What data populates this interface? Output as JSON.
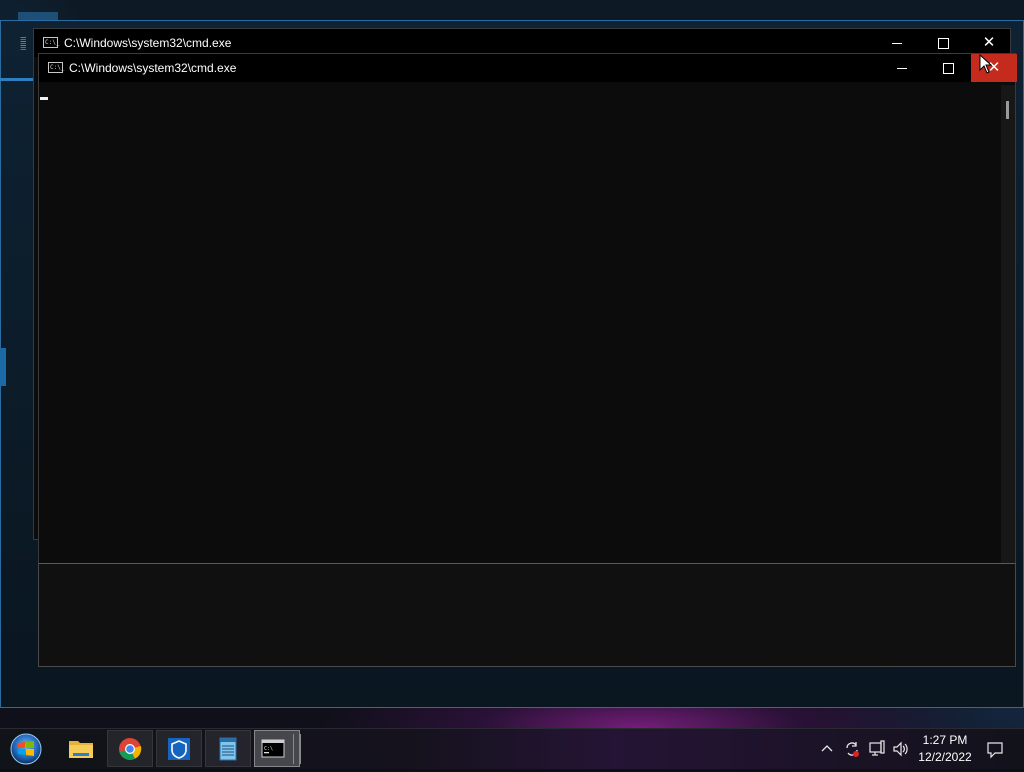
{
  "windows": [
    {
      "id": "cmd-back",
      "title": "C:\\Windows\\system32\\cmd.exe",
      "icon": "cmd-icon",
      "controls": {
        "minimize": "minimize-icon",
        "maximize": "maximize-icon",
        "close": "close-icon"
      }
    },
    {
      "id": "cmd-front",
      "title": "C:\\Windows\\system32\\cmd.exe",
      "icon": "cmd-icon",
      "controls": {
        "minimize": "minimize-icon",
        "maximize": "maximize-icon",
        "close": "close-icon"
      },
      "close_hover_color": "#c42b1c",
      "console_text": ""
    }
  ],
  "taskbar": {
    "start_icon": "windows-start-icon",
    "items": [
      {
        "name": "file-explorer",
        "icon": "folder-icon",
        "state": "normal"
      },
      {
        "name": "chrome",
        "icon": "chrome-icon",
        "state": "pinned"
      },
      {
        "name": "windows-defender",
        "icon": "shield-icon",
        "state": "pinned"
      },
      {
        "name": "notepad",
        "icon": "notepad-icon",
        "state": "pinned"
      },
      {
        "name": "command-prompt",
        "icon": "cmd-icon",
        "state": "active"
      }
    ],
    "tray": {
      "icons": [
        "chevron-up-icon",
        "sync-icon",
        "network-icon",
        "volume-icon"
      ],
      "time": "1:27 PM",
      "date": "12/2/2022",
      "notification_icon": "notification-icon"
    }
  },
  "colors": {
    "accent_blue": "#2a6ca0",
    "console_bg": "#0c0c0c",
    "close_red": "#c42b1c"
  }
}
